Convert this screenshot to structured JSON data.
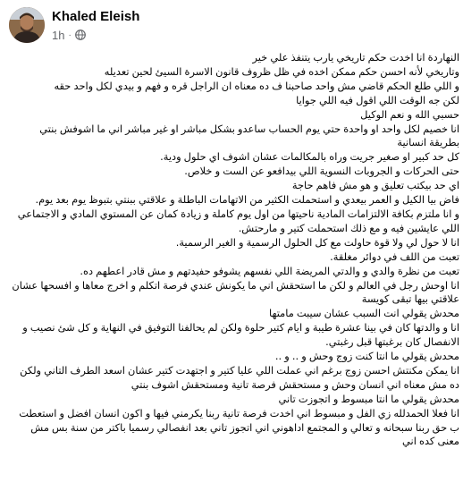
{
  "post": {
    "author": "Khaled Eleish",
    "time": "1h",
    "lines": [
      "النهاردة انا اخدت حكم تاريخي يارب يتنفذ علي خير",
      "وتاريخي لأنه احسن حكم ممكن اخده في ظل ظروف قانون الاسرة السيئ لحين تعديله",
      "و اللي طلع الحكم قاضي مش واحد صاحبنا ف ده معناه ان الراجل قره و فهم و بيدي لكل واحد حقه",
      "لكن جه الوقت اللي اقول فيه اللي جوايا",
      "حسبي الله و نعم الوكيل",
      "انا خصيم لكل واحد او واحدة حتي يوم الحساب ساعدو بشكل مباشر او غير مباشر اني ما اشوفش بنتي بطريقة انسانية",
      "كل حد كبير او صغير جريت وراه بالمكالمات عشان اشوف اي حلول ودية.",
      "حتى الحركات و الجروبات النسوية اللي بيدافعو عن الست و خلاص.",
      "اي حد بيكتب تعليق و هو مش فاهم حاجة",
      "فاض بيا الكيل و العمر بيعدي و استحملت الكثير من الاتهامات الباطلة و علاقتي ببنتي بتبوظ يوم بعد يوم.",
      "و انا ملتزم بكافة الالتزامات المادية ناحيتها من اول يوم كاملة و زيادة كمان عن المستوي المادي و الاجتماعي اللي عايشين فيه و مع ذلك استحملت كتير و مارحتش.",
      "انا لا حول لي ولا قوة حاولت مع كل الحلول الرسمية و الغير الرسمية.",
      "تعبت من اللف في دوائر مغلقة.",
      "تعبت من نظرة والدي و والدتي المريضة اللي نفسهم يشوفو حفيدتهم و مش قادر اعطهم ده.",
      "انا اوحش رجل في العالم و لكن ما استحقش اني ما يكونش عندي فرصة اتكلم و اخرج معاها و افسحها عشان علاقتي بيها تبقى كويسة",
      "محدش يقولي انت السبب عشان سيبت مامتها",
      "انا و والدتها كان في بينا عشرة طيبة و ايام كتير حلوة ولكن لم يحالفنا التوفيق في النهاية و كل شئ نصيب و الانفصال كان برغبتها قبل رغبتي.",
      "محدش يقولي ما انتا كنت زوج وحش و .. و ..",
      "انا يمكن مكنتش احسن زوج برغم اني عملت اللي عليا كتير و اجتهدت كتير عشان اسعد الطرف التاني ولكن ده مش معناه اني انسان وحش و مستحقش فرصة تانية ومستحقش اشوف بنتي",
      "محدش يقولي ما انتا مبسوط و اتجوزت تاني",
      "انا فعلا الحمدلله زي الفل و مبسوط اني اخدت فرصة تانية ربنا يكرمني فيها و اكون انسان افضل و استعطت ب حق ربنا سبحانه و تعالي و المجتمع اداهوني اني اتجوز تاني بعد انفصالي رسميا باكتر من سنة بس مش معنى كده اني"
    ]
  }
}
